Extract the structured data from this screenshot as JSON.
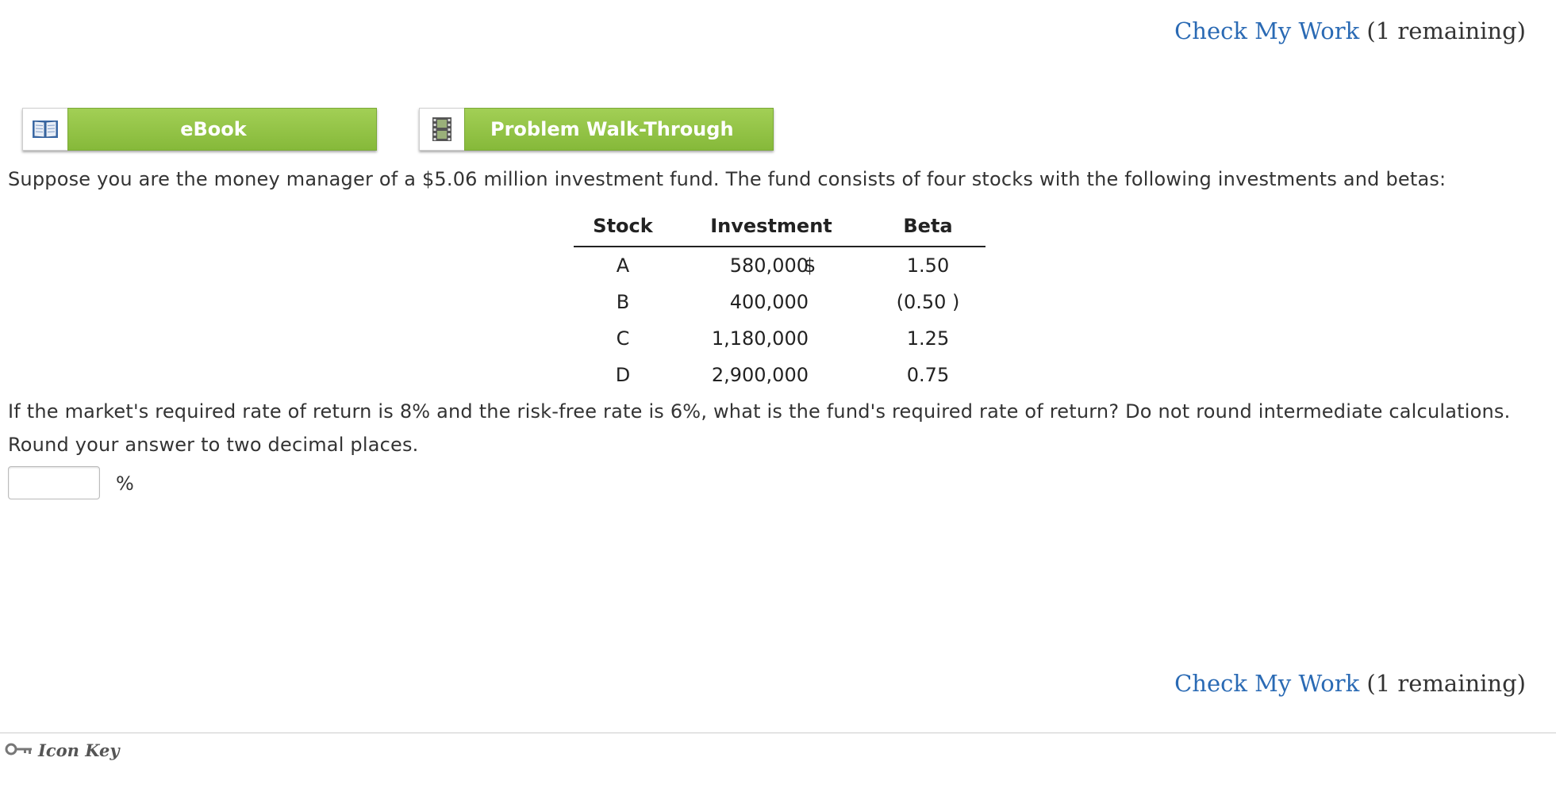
{
  "header": {
    "check_my_work_label": "Check My Work",
    "remaining_label": "(1 remaining)"
  },
  "tools": {
    "ebook_label": "eBook",
    "walkthrough_label": "Problem Walk-Through",
    "ebook_icon": "book-icon",
    "walkthrough_icon": "film-icon",
    "button_color": "#8fc33f"
  },
  "question": {
    "intro": "Suppose you are the money manager of a $5.06 million investment fund. The fund consists of four stocks with the following investments and betas:",
    "prompt": "If the market's required rate of return is 8% and the risk-free rate is 6%, what is the fund's required rate of return? Do not round intermediate calculations. Round your answer to two decimal places."
  },
  "table": {
    "headers": [
      "Stock",
      "Investment",
      "Beta"
    ],
    "rows": [
      {
        "stock": "A",
        "currency": "$",
        "investment": "580,000",
        "beta": "1.50"
      },
      {
        "stock": "B",
        "currency": "",
        "investment": "400,000",
        "beta": "(0.50 )"
      },
      {
        "stock": "C",
        "currency": "",
        "investment": "1,180,000",
        "beta": "1.25"
      },
      {
        "stock": "D",
        "currency": "",
        "investment": "2,900,000",
        "beta": "0.75"
      }
    ]
  },
  "answer": {
    "value": "",
    "unit": "%"
  },
  "footer": {
    "check_my_work_label": "Check My Work",
    "remaining_label": "(1 remaining)",
    "icon_key_label": "Icon Key",
    "icon_key_icon": "key-icon"
  },
  "colors": {
    "link": "#2a6ab4",
    "text": "#333333"
  }
}
